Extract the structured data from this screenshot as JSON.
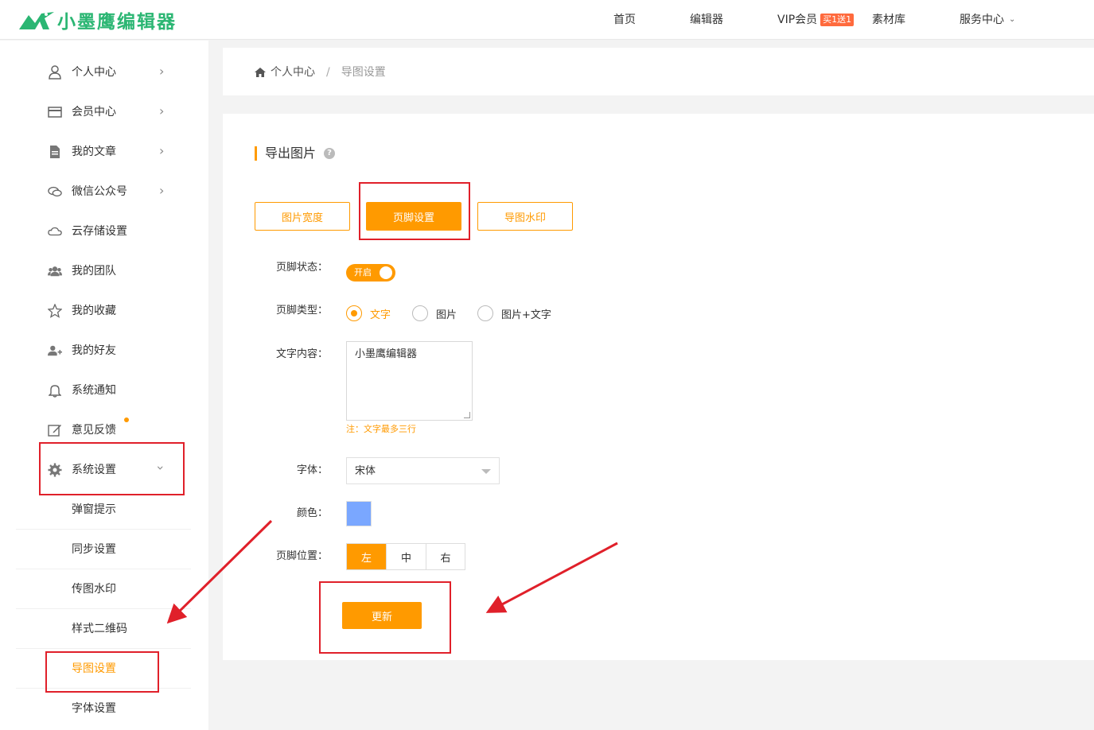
{
  "brand": {
    "name": "小墨鹰编辑器",
    "color": "#2bb673",
    "logo_icon": "eagle-logo-icon"
  },
  "topnav": {
    "items": [
      {
        "label": "首页"
      },
      {
        "label": "编辑器"
      },
      {
        "label": "VIP会员",
        "badge": "买1送1"
      },
      {
        "label": "素材库"
      },
      {
        "label": "服务中心",
        "icon": "chevron-down-icon"
      }
    ]
  },
  "sidebar": {
    "items": [
      {
        "label": "个人中心",
        "icon": "user-icon",
        "has_arrow": true
      },
      {
        "label": "会员中心",
        "icon": "card-icon",
        "has_arrow": true
      },
      {
        "label": "我的文章",
        "icon": "document-icon",
        "has_arrow": true
      },
      {
        "label": "微信公众号",
        "icon": "chat-icon",
        "has_arrow": true
      },
      {
        "label": "云存储设置",
        "icon": "cloud-icon"
      },
      {
        "label": "我的团队",
        "icon": "team-icon"
      },
      {
        "label": "我的收藏",
        "icon": "star-icon"
      },
      {
        "label": "我的好友",
        "icon": "add-friend-icon"
      },
      {
        "label": "系统通知",
        "icon": "bell-icon"
      },
      {
        "label": "意见反馈",
        "icon": "edit-icon",
        "dot": true
      },
      {
        "label": "系统设置",
        "icon": "gear-icon",
        "expanded": true
      }
    ],
    "subitems": [
      {
        "label": "弹窗提示"
      },
      {
        "label": "同步设置"
      },
      {
        "label": "传图水印"
      },
      {
        "label": "样式二维码"
      },
      {
        "label": "导图设置",
        "active": true
      },
      {
        "label": "字体设置"
      }
    ]
  },
  "breadcrumb": {
    "home_icon": "home-icon",
    "home": "个人中心",
    "separator": "/",
    "current": "导图设置"
  },
  "main": {
    "title": "导出图片",
    "help_icon": "question-icon",
    "help_glyph": "?",
    "tabs": [
      {
        "label": "图片宽度"
      },
      {
        "label": "页脚设置",
        "active": true
      },
      {
        "label": "导图水印"
      }
    ],
    "footer_status": {
      "label": "页脚状态：",
      "switch_text": "开启",
      "on": true
    },
    "footer_type": {
      "label": "页脚类型：",
      "options": [
        {
          "label": "文字",
          "checked": true
        },
        {
          "label": "图片"
        },
        {
          "label": "图片+文字"
        }
      ]
    },
    "text_content": {
      "label": "文字内容：",
      "value": "小墨鹰编辑器",
      "note": "注：文字最多三行"
    },
    "font": {
      "label": "字体：",
      "value": "宋体"
    },
    "color": {
      "label": "颜色：",
      "value": "#7aa7ff"
    },
    "position": {
      "label": "页脚位置：",
      "options": [
        "左",
        "中",
        "右"
      ],
      "selected": "左"
    },
    "update_label": "更新"
  },
  "theme": {
    "accent": "#ff9a00",
    "annotation": "#e0202a"
  }
}
